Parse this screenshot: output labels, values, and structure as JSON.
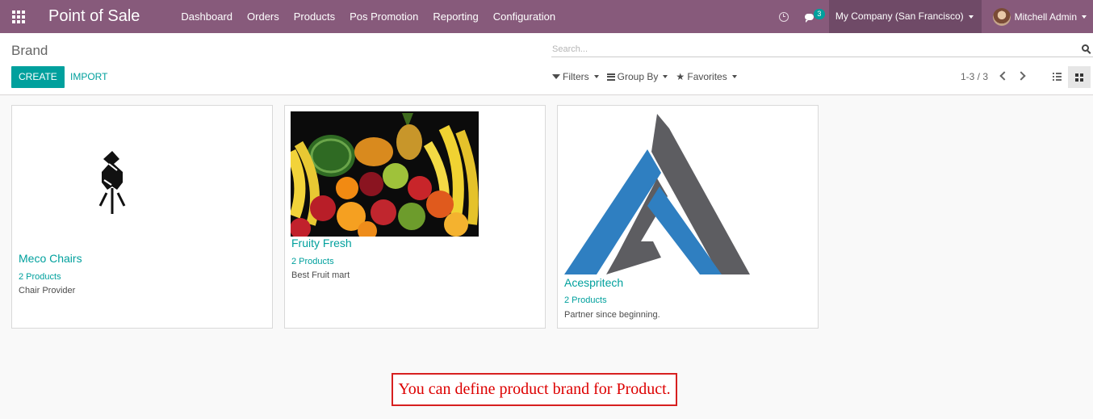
{
  "navbar": {
    "app_title": "Point of Sale",
    "menu": [
      "Dashboard",
      "Orders",
      "Products",
      "Pos Promotion",
      "Reporting",
      "Configuration"
    ],
    "message_count": "3",
    "company": "My Company (San Francisco)",
    "user": "Mitchell Admin",
    "icons": [
      "apps-menu-icon",
      "clock-icon",
      "chat-icon",
      "avatar"
    ],
    "brand_color": "#875a7b"
  },
  "control": {
    "breadcrumb": "Brand",
    "search_placeholder": "Search...",
    "create_label": "CREATE",
    "import_label": "IMPORT",
    "filters_label": "Filters",
    "group_by_label": "Group By",
    "favorites_label": "Favorites",
    "pager": "1-3 / 3",
    "active_view": "kanban",
    "accent_color": "#00a09d"
  },
  "brands": [
    {
      "name": "Meco Chairs",
      "count": "2 Products",
      "description": "Chair Provider",
      "image": "chair-logo"
    },
    {
      "name": "Fruity Fresh",
      "count": "2 Products",
      "description": "Best Fruit mart",
      "image": "fruit-photo"
    },
    {
      "name": "Acespritech",
      "count": "2 Products",
      "description": "Partner since beginning.",
      "image": "triangle-logo"
    }
  ],
  "annotation": "You can define product brand for Product."
}
